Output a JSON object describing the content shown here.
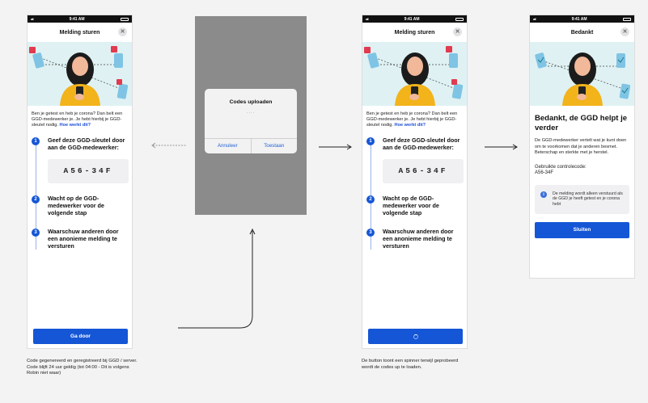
{
  "status_bar": {
    "time": "9:41 AM",
    "signal": "atl"
  },
  "screen1": {
    "title": "Melding sturen",
    "intro_text": "Ben je getest en heb je corona? Dan belt een GGD-medewerker je. Je hebt hierbij je GGD-sleutel nodig.",
    "help_link": "Hoe werkt dit?",
    "steps": [
      {
        "num": "1",
        "text": "Geef deze GGD-sleutel door aan de GGD-medewerker:"
      },
      {
        "num": "2",
        "text": "Wacht op de GGD-medewerker voor de volgende stap"
      },
      {
        "num": "3",
        "text": "Waarschuw anderen door een anonieme melding te versturen"
      }
    ],
    "code": "A56-34F",
    "button_label": "Ga door",
    "caption": "Code gegenereerd en geregistreerd bij GGD / server. Code blijft 24 uur geldig (tot 04:00 - Dit is volgens Robin niet waar)"
  },
  "dialog": {
    "title": "Codes uploaden",
    "dots": "....",
    "cancel_label": "Annuleer",
    "allow_label": "Toestaan"
  },
  "screen3": {
    "title": "Melding sturen",
    "intro_text": "Ben je getest en heb je corona? Dan belt een GGD-medewerker je. Je hebt hierbij je GGD-sleutel nodig.",
    "help_link": "Hoe werkt dit?",
    "steps": [
      {
        "num": "1",
        "text": "Geef deze GGD-sleutel door aan de GGD-medewerker:"
      },
      {
        "num": "2",
        "text": "Wacht op de GGD-medewerker voor de volgende stap"
      },
      {
        "num": "3",
        "text": "Waarschuw anderen door een anonieme melding te versturen"
      }
    ],
    "code": "A56-34F",
    "caption": "De button toont een spinner terwijl geprobeerd wordt de codes up te loaden."
  },
  "screen4": {
    "title": "Bedankt",
    "heading": "Bedankt, de GGD helpt je verder",
    "paragraph": "De GGD-medewerker vertelt wat je kunt doen om te voorkomen dat je anderen besmet. Beterschap en sterkte met je herstel.",
    "used_code_label": "Gebruikte controlecode:",
    "used_code": "A56-34F",
    "info_text": "De melding wordt alleen verstuurd als de GGD je heeft getest en je corona hebt",
    "info_icon": "i",
    "close_label": "Sluiten"
  },
  "colors": {
    "primary": "#1556d6",
    "illustration_bg": "#dff1f3",
    "canvas_bg": "#f3f3f3"
  }
}
